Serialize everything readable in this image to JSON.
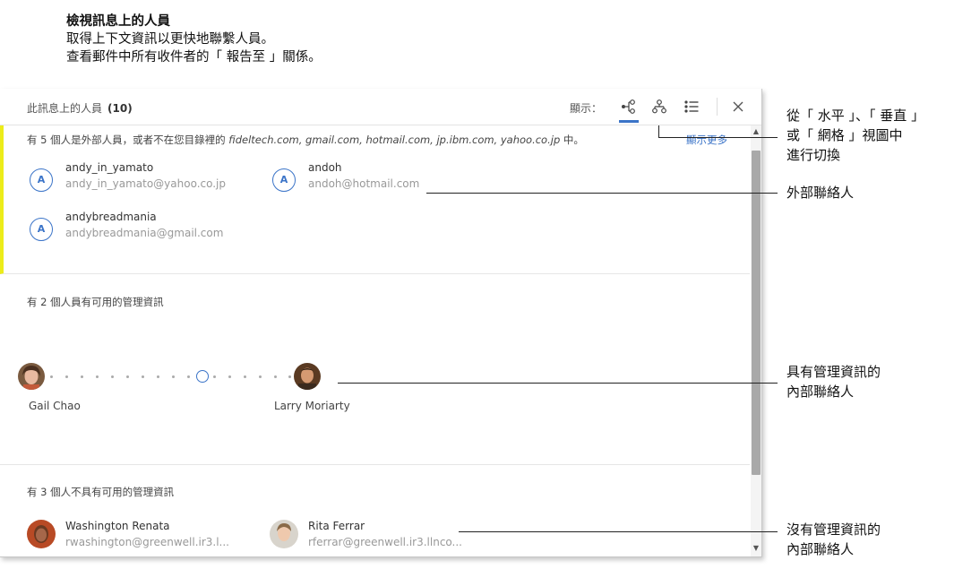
{
  "intro": {
    "title": "檢視訊息上的人員",
    "line1": "取得上下文資訊以更快地聯繫人員。",
    "line2": "查看郵件中所有收件者的「 報告至 」關係。"
  },
  "panel": {
    "title": "此訊息上的人員",
    "count": "(10)",
    "show_label": "顯示：",
    "more": "顯示更多"
  },
  "external": {
    "note_prefix": "有 5 個人是外部人員，或者不在您目錄裡的",
    "domains": "fideltech.com, gmail.com, hotmail.com, jp.ibm.com, yahoo.co.jp",
    "note_suffix": "中。",
    "people": [
      {
        "initial": "A",
        "name": "andy_in_yamato",
        "email": "andy_in_yamato@yahoo.co.jp"
      },
      {
        "initial": "A",
        "name": "andoh",
        "email": "andoh@hotmail.com"
      },
      {
        "initial": "A",
        "name": "andybreadmania",
        "email": "andybreadmania@gmail.com"
      }
    ]
  },
  "managed": {
    "title": "有 2 個人員有可用的管理資訊",
    "people": [
      {
        "name": "Gail Chao"
      },
      {
        "name": "Larry Moriarty"
      }
    ]
  },
  "unmanaged": {
    "title": "有 3 個人不具有可用的管理資訊",
    "people": [
      {
        "name": "Washington Renata",
        "email": "rwashington@greenwell.ir3.l..."
      },
      {
        "name": "Rita Ferrar",
        "email": "rferrar@greenwell.ir3.llnco..."
      }
    ]
  },
  "callouts": {
    "switch_line1": "從「 水平 」、「 垂直 」",
    "switch_line2": "或「 網格 」視圖中",
    "switch_line3": "進行切換",
    "external": "外部聯絡人",
    "managed_line1": "具有管理資訊的",
    "managed_line2": "內部聯絡人",
    "unmanaged_line1": "沒有管理資訊的",
    "unmanaged_line2": "內部聯絡人"
  },
  "colors": {
    "accent": "#3b74c8",
    "external_bar": "#ecec1a"
  }
}
